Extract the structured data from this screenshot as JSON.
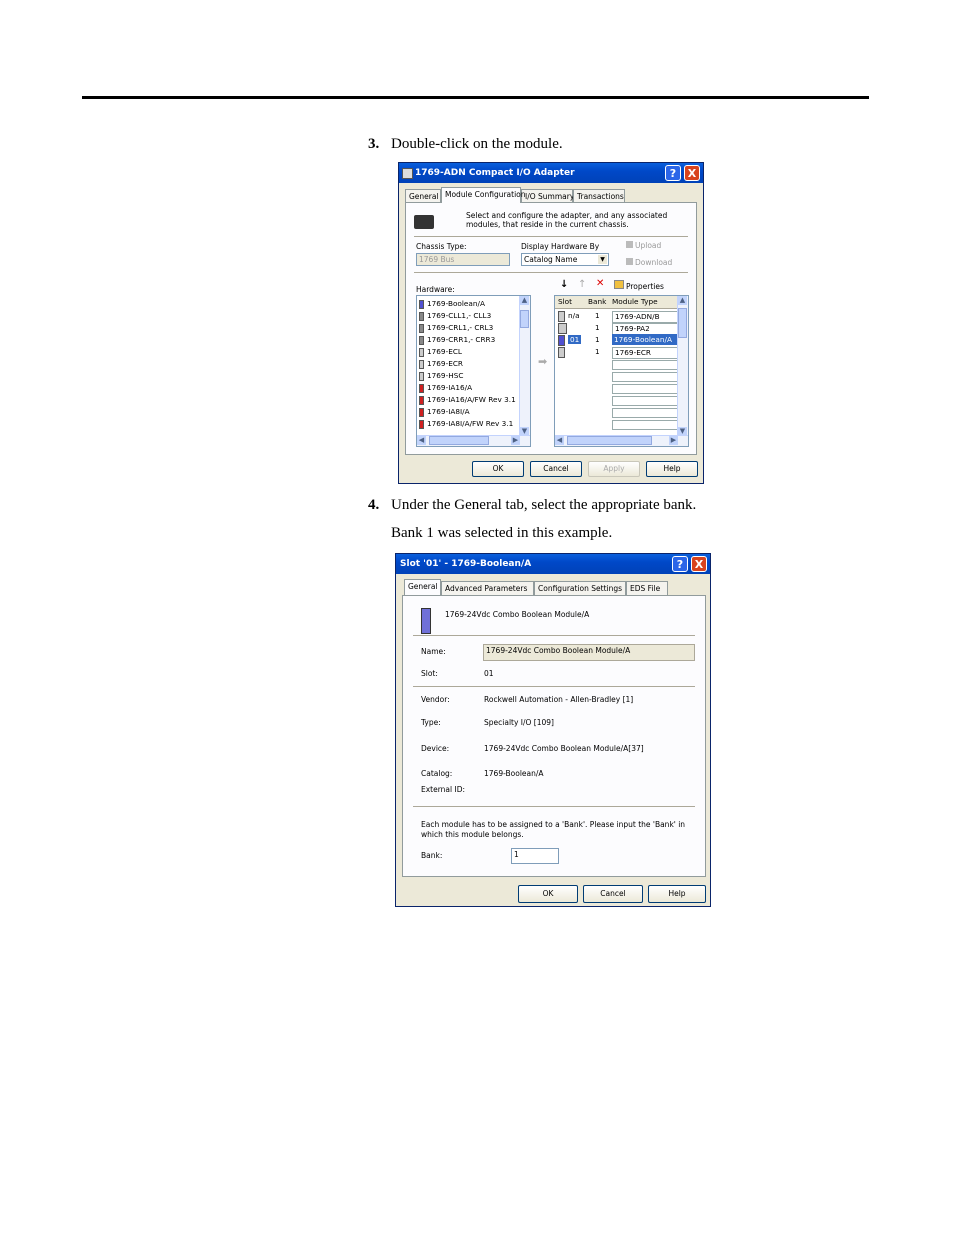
{
  "step3": {
    "number": "3.",
    "text": "Double-click on the module."
  },
  "step4": {
    "number": "4.",
    "text": "Under the General tab, select the appropriate bank.",
    "note": "Bank 1 was selected in this example."
  },
  "dialog1": {
    "title": "1769-ADN Compact I/O Adapter",
    "help": "?",
    "close": "X",
    "tabs": [
      "General",
      "Module Configuration",
      "I/O Summary",
      "Transactions"
    ],
    "description": "Select and configure the adapter, and any associated modules, that reside in the current chassis.",
    "chassis_type_label": "Chassis Type:",
    "chassis_type_value": "1769 Bus",
    "display_hardware_label": "Display Hardware By",
    "display_hardware_value": "Catalog Name",
    "upload": "Upload",
    "download": "Download",
    "hardware_label": "Hardware:",
    "properties": "Properties",
    "hardware_items": [
      "1769-Boolean/A",
      "1769-CLL1,- CLL3",
      "1769-CRL1,- CRL3",
      "1769-CRR1,- CRR3",
      "1769-ECL",
      "1769-ECR",
      "1769-HSC",
      "1769-IA16/A",
      "1769-IA16/A/FW Rev 3.1",
      "1769-IA8I/A",
      "1769-IA8I/A/FW Rev 3.1"
    ],
    "columns": [
      "Slot",
      "Bank",
      "Module Type"
    ],
    "rows": [
      {
        "slot": "n/a",
        "bank": "1",
        "type": "1769-ADN/B"
      },
      {
        "slot": "",
        "bank": "1",
        "type": "1769-PA2"
      },
      {
        "slot": "01",
        "bank": "1",
        "type": "1769-Boolean/A"
      },
      {
        "slot": "",
        "bank": "1",
        "type": "1769-ECR"
      }
    ],
    "ok": "OK",
    "cancel": "Cancel",
    "apply": "Apply",
    "help_btn": "Help"
  },
  "dialog2": {
    "title": "Slot '01' - 1769-Boolean/A",
    "help": "?",
    "close": "X",
    "tabs": [
      "General",
      "Advanced Parameters",
      "Configuration Settings",
      "EDS File"
    ],
    "module_desc": "1769-24Vdc Combo Boolean Module/A",
    "name_label": "Name:",
    "name_value": "1769-24Vdc Combo Boolean Module/A",
    "slot_label": "Slot:",
    "slot_value": "01",
    "vendor_label": "Vendor:",
    "vendor_value": "Rockwell Automation - Allen-Bradley [1]",
    "type_label": "Type:",
    "type_value": "Specialty I/O [109]",
    "device_label": "Device:",
    "device_value": "1769-24Vdc Combo Boolean Module/A[37]",
    "catalog_label": "Catalog:",
    "catalog_value": "1769-Boolean/A",
    "external_id_label": "External ID:",
    "bank_instruction": "Each module has to be assigned to a 'Bank'. Please input the 'Bank' in which this module belongs.",
    "bank_label": "Bank:",
    "bank_value": "1",
    "ok": "OK",
    "cancel": "Cancel",
    "help_btn": "Help"
  }
}
